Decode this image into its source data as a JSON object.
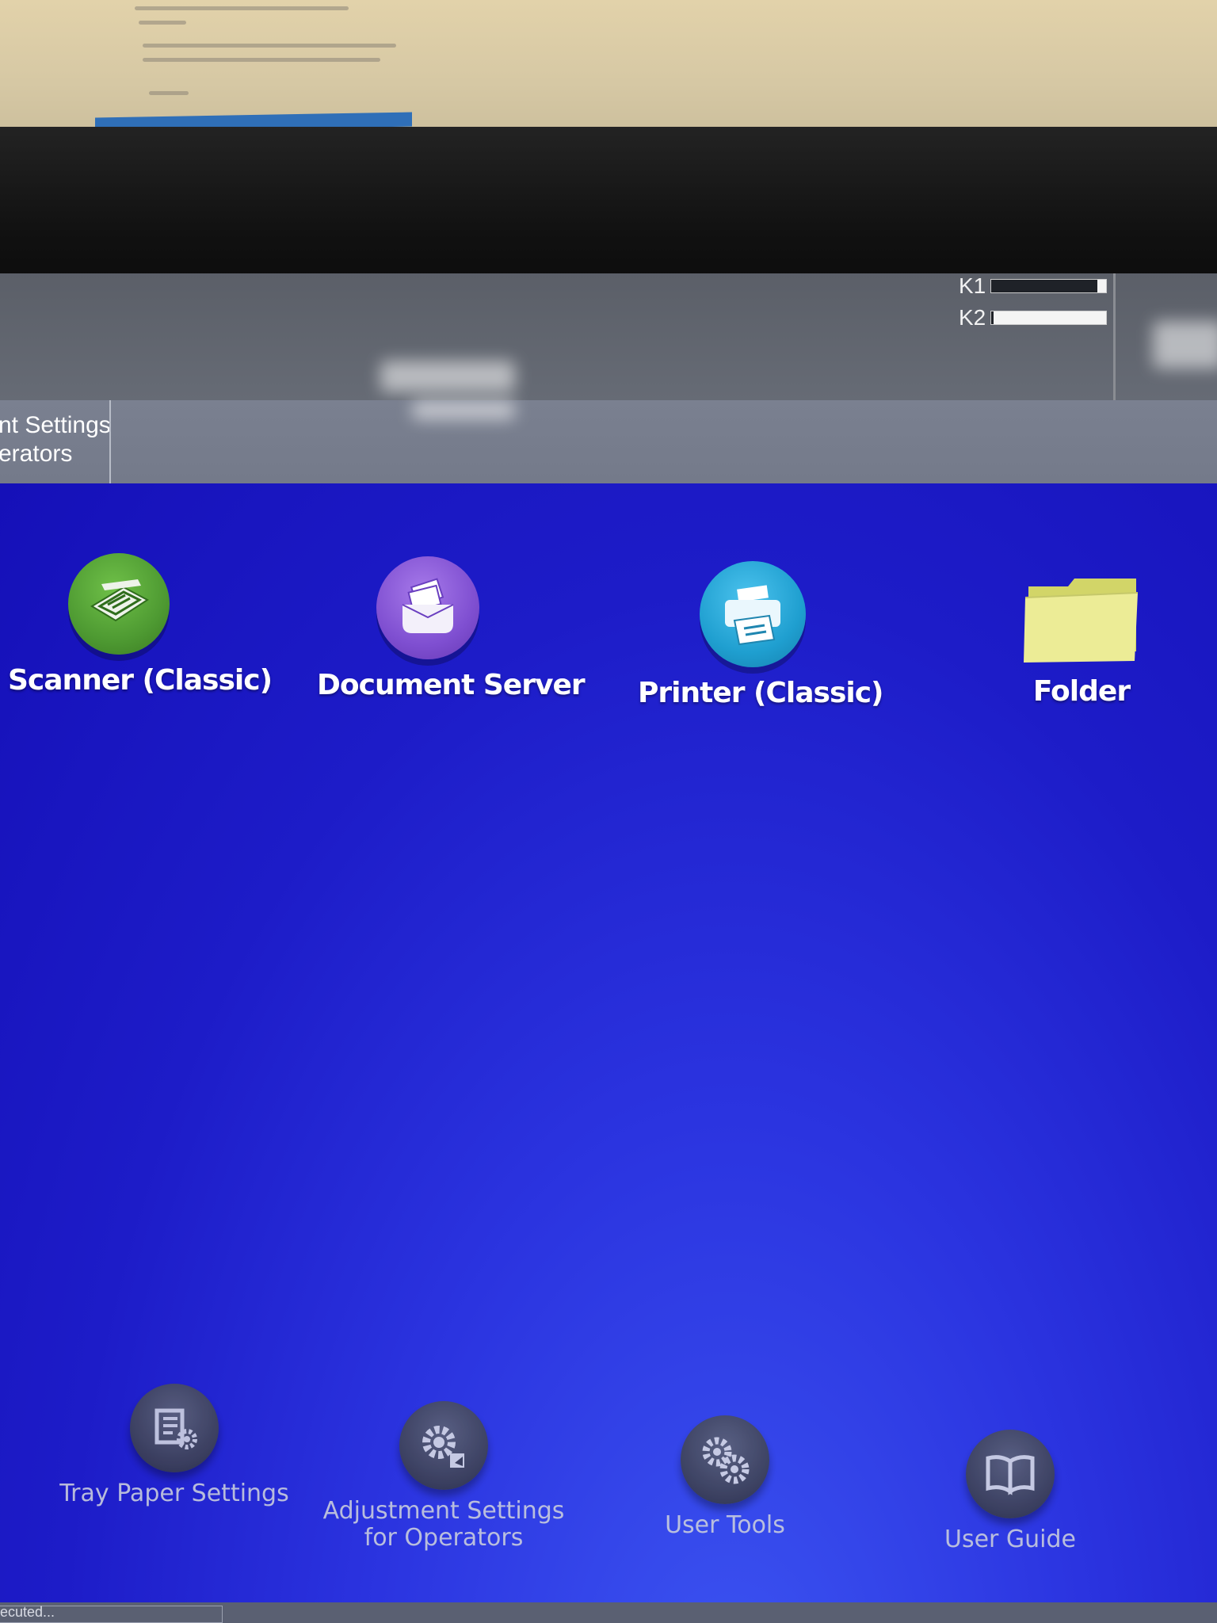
{
  "toner": [
    {
      "label": "K1",
      "level": 0.08
    },
    {
      "label": "K2",
      "level": 0.98
    }
  ],
  "tab": {
    "line1": "nt Settings",
    "line2": "erators"
  },
  "apps": [
    {
      "label": "Scanner (Classic)",
      "icon": "scanner-icon",
      "color": "#4e9a32"
    },
    {
      "label": "Document Server",
      "icon": "document-server-icon",
      "color": "#7f4fd1"
    },
    {
      "label": "Printer (Classic)",
      "icon": "printer-icon",
      "color": "#1f9fd0"
    },
    {
      "label": "Folder",
      "icon": "folder-icon",
      "color": "#ecec92"
    }
  ],
  "tools": [
    {
      "label": "Tray Paper Settings",
      "icon": "tray-settings-icon"
    },
    {
      "label": "Adjustment Settings for Operators",
      "icon": "adjustment-settings-icon"
    },
    {
      "label": "User Tools",
      "icon": "gears-icon"
    },
    {
      "label": "User Guide",
      "icon": "book-icon"
    }
  ],
  "status": {
    "text": "ecuted..."
  }
}
